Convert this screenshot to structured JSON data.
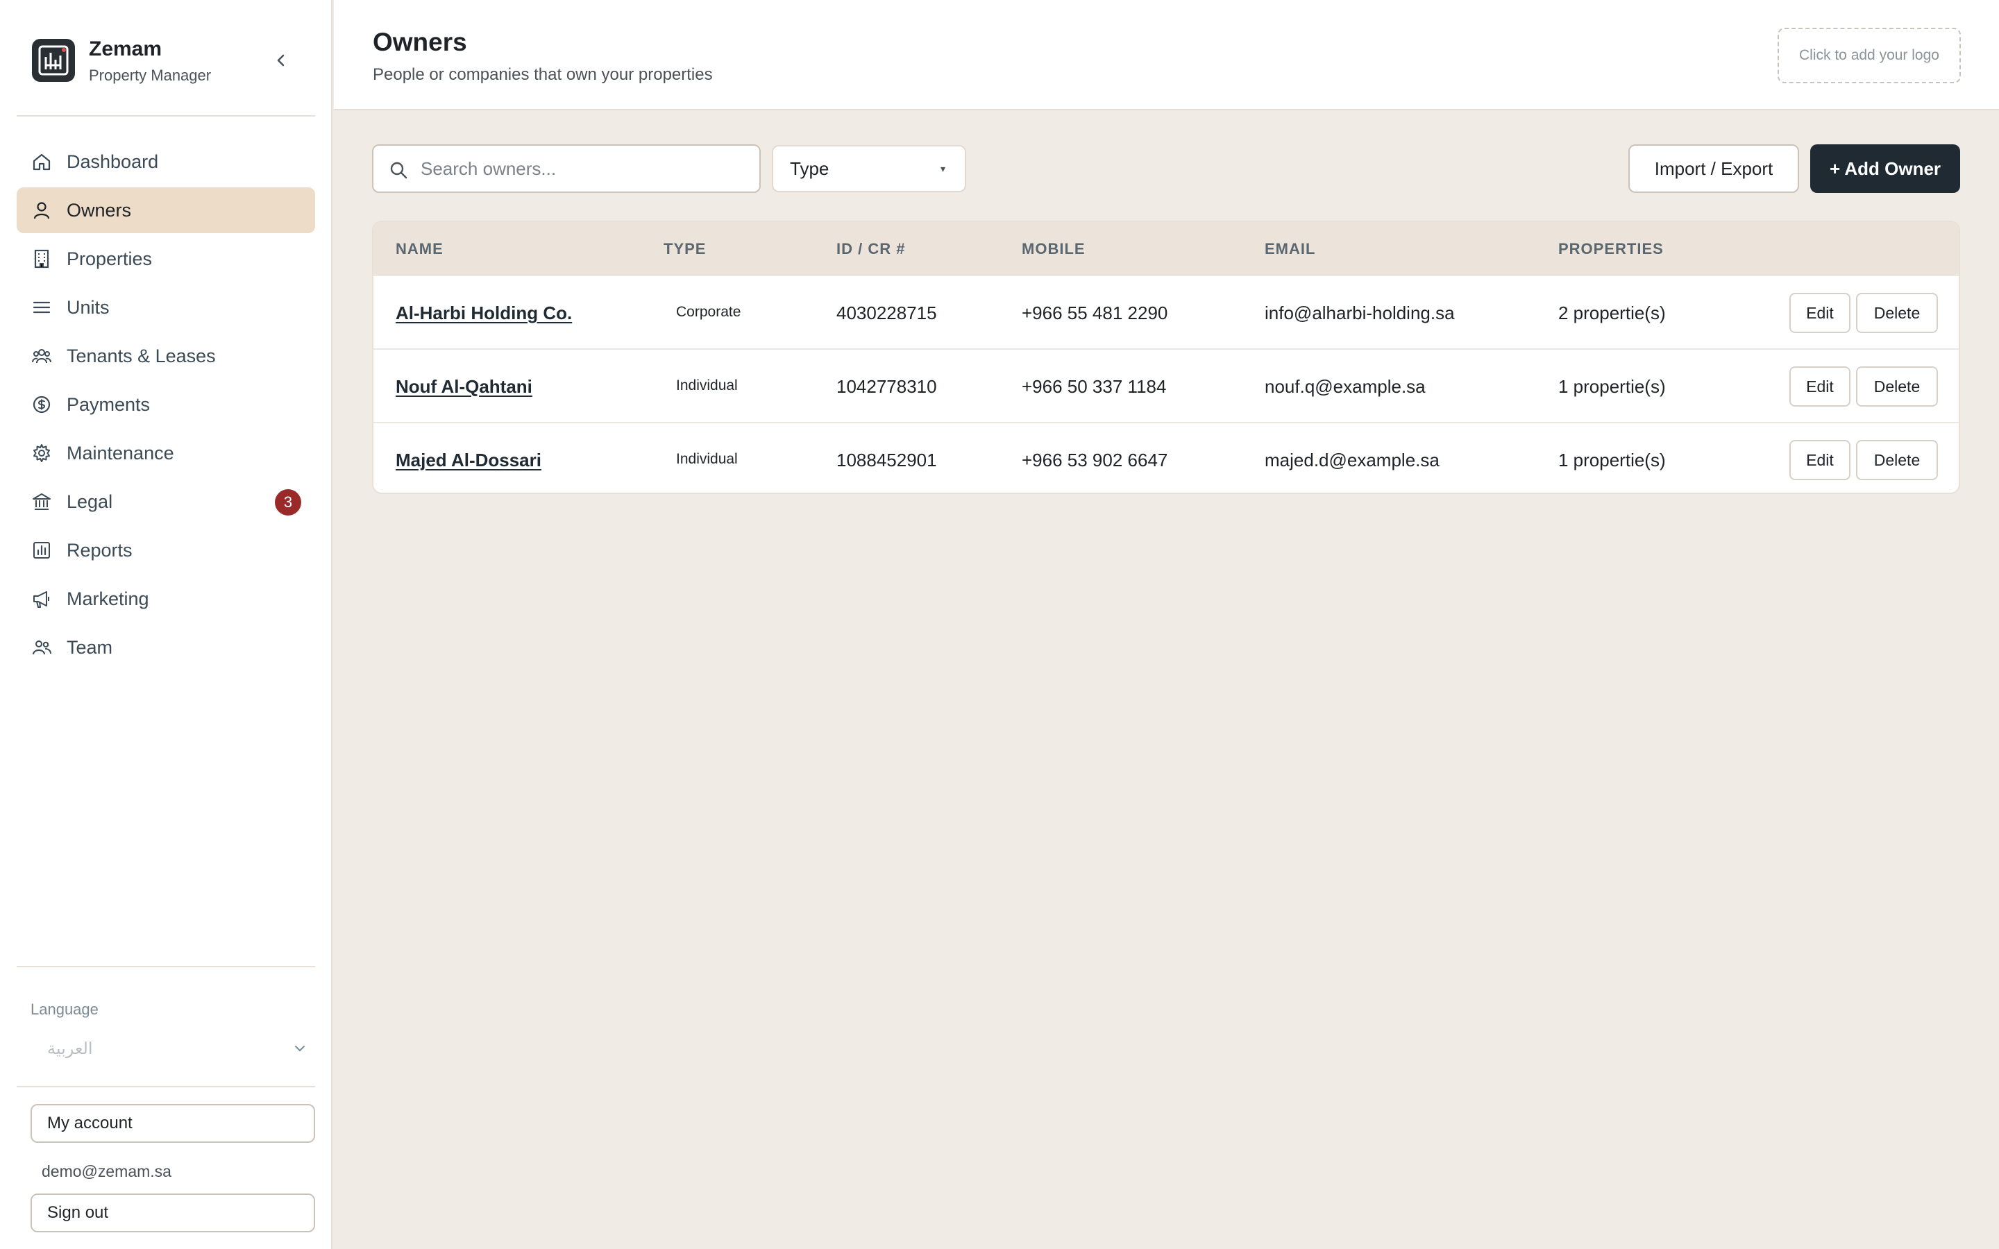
{
  "app": {
    "name": "Zemam",
    "subtitle": "Property Manager"
  },
  "sidebar": {
    "items": [
      {
        "label": "Dashboard",
        "icon": "home-icon",
        "active": false
      },
      {
        "label": "Owners",
        "icon": "user-icon",
        "active": true
      },
      {
        "label": "Properties",
        "icon": "building-icon",
        "active": false
      },
      {
        "label": "Units",
        "icon": "list-icon",
        "active": false
      },
      {
        "label": "Tenants & Leases",
        "icon": "users-icon",
        "active": false
      },
      {
        "label": "Payments",
        "icon": "dollar-circle-icon",
        "active": false
      },
      {
        "label": "Maintenance",
        "icon": "gear-icon",
        "active": false
      },
      {
        "label": "Legal",
        "icon": "bank-icon",
        "active": false,
        "badge": "3"
      },
      {
        "label": "Reports",
        "icon": "chart-icon",
        "active": false
      },
      {
        "label": "Marketing",
        "icon": "megaphone-icon",
        "active": false
      },
      {
        "label": "Team",
        "icon": "team-icon",
        "active": false
      }
    ],
    "language_label": "Language",
    "language_value": "العربية",
    "my_account": "My account",
    "email": "demo@zemam.sa",
    "sign_out": "Sign out"
  },
  "header": {
    "title": "Owners",
    "subtitle": "People or companies that own your properties",
    "logo_placeholder": "Click to add your logo"
  },
  "toolbar": {
    "search_placeholder": "Search owners...",
    "type_filter": "Type",
    "import_export": "Import / Export",
    "add_owner": "+ Add Owner"
  },
  "table": {
    "columns": [
      "NAME",
      "TYPE",
      "ID / CR #",
      "MOBILE",
      "EMAIL",
      "PROPERTIES"
    ],
    "edit_label": "Edit",
    "delete_label": "Delete",
    "rows": [
      {
        "name": "Al-Harbi Holding Co.",
        "type": "Corporate",
        "id": "4030228715",
        "mobile": "+966 55 481 2290",
        "email": "info@alharbi-holding.sa",
        "properties": "2 propertie(s)"
      },
      {
        "name": "Nouf Al-Qahtani",
        "type": "Individual",
        "id": "1042778310",
        "mobile": "+966 50 337 1184",
        "email": "nouf.q@example.sa",
        "properties": "1 propertie(s)"
      },
      {
        "name": "Majed Al-Dossari",
        "type": "Individual",
        "id": "1088452901",
        "mobile": "+966 53 902 6647",
        "email": "majed.d@example.sa",
        "properties": "1 propertie(s)"
      }
    ]
  },
  "colors": {
    "active_nav": "#ecdcc8",
    "primary_button": "#1f2a33",
    "badge": "#9a2a2a",
    "background": "#f0ebe4"
  }
}
